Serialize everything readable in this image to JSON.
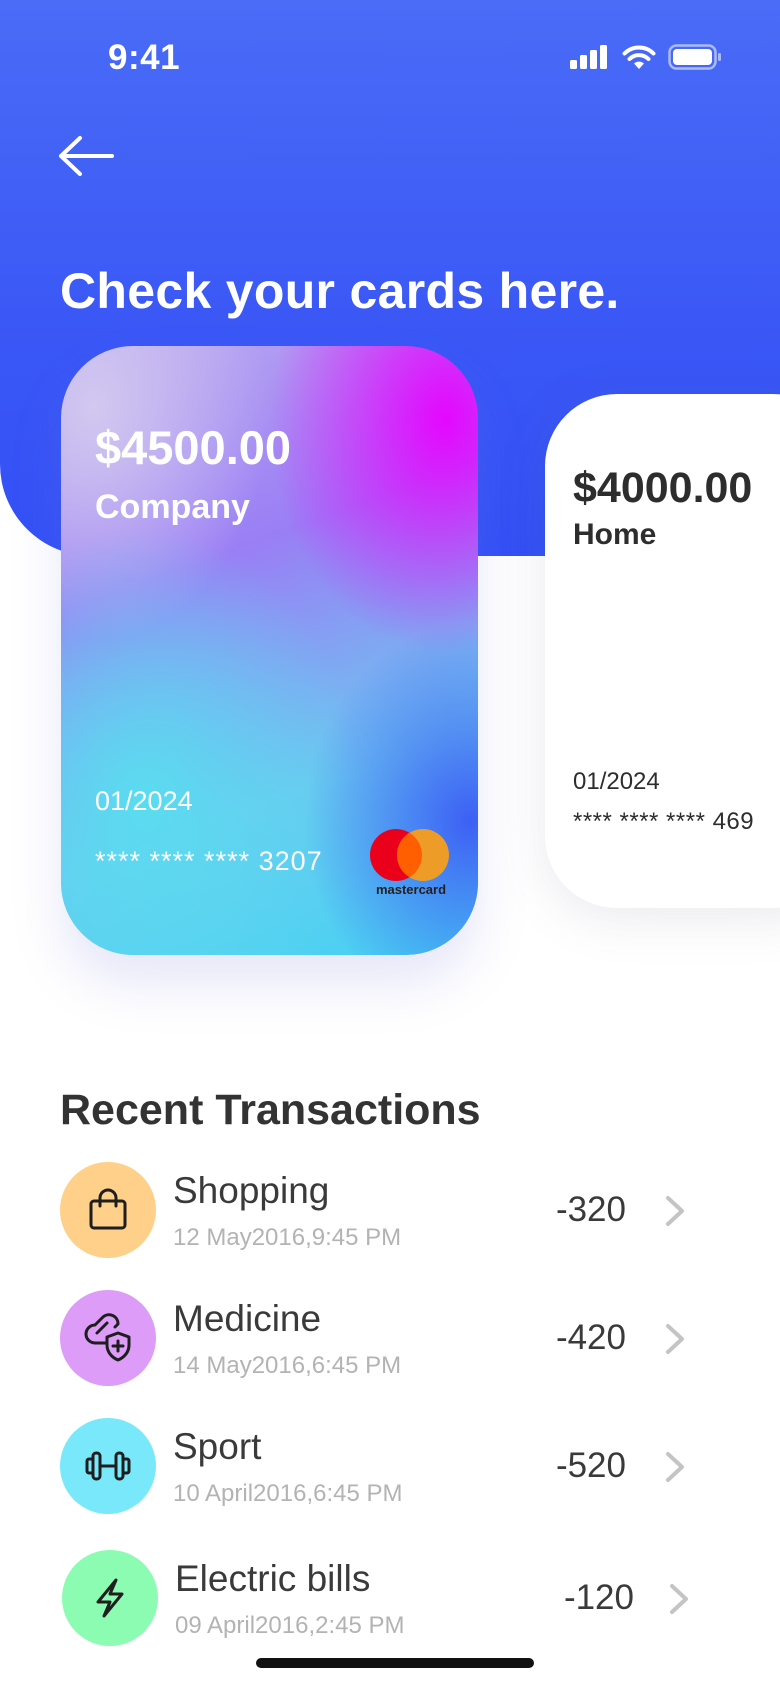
{
  "status": {
    "time": "9:41"
  },
  "header": {
    "title": "Check your cards here."
  },
  "cards": [
    {
      "amount": "$4500.00",
      "label": "Company",
      "expiry": "01/2024",
      "number": "**** **** **** 3207",
      "brand": "mastercard"
    },
    {
      "amount": "$4000.00",
      "label": "Home",
      "expiry": "01/2024",
      "number": "**** **** **** 469"
    }
  ],
  "transactions": {
    "title": "Recent Transactions",
    "items": [
      {
        "name": "Shopping",
        "date": "12 May2016,9:45 PM",
        "amount": "-320",
        "icon": "shopping-bag-icon",
        "color": "#ffd08a"
      },
      {
        "name": "Medicine",
        "date": "14 May2016,6:45 PM",
        "amount": "-420",
        "icon": "medicine-icon",
        "color": "#dc9cf8"
      },
      {
        "name": "Sport",
        "date": "10 April2016,6:45 PM",
        "amount": "-520",
        "icon": "dumbbell-icon",
        "color": "#7ae8fb"
      },
      {
        "name": "Electric bills",
        "date": "09 April2016,2:45 PM",
        "amount": "-120",
        "icon": "lightning-icon",
        "color": "#8bfcb2"
      }
    ]
  },
  "colors": {
    "primary": "#3a57f6",
    "text": "#333333",
    "muted": "#b3b3b3"
  }
}
